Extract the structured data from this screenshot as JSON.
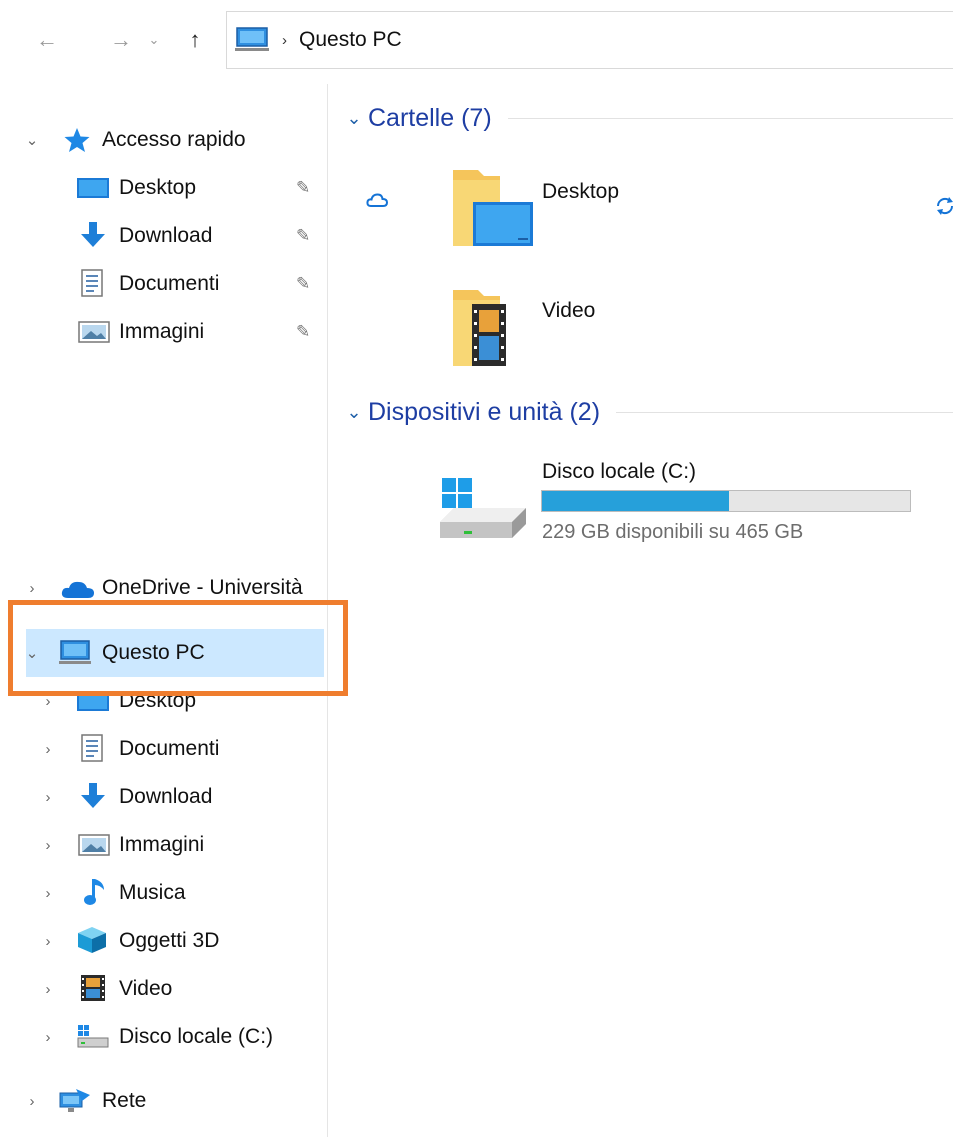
{
  "nav": {
    "back_icon": "arrow-left",
    "forward_icon": "arrow-right",
    "recent_icon": "chevron-down",
    "up_icon": "arrow-up",
    "back_glyph": "←",
    "forward_glyph": "→",
    "recent_glyph": "⌄",
    "up_glyph": "↑",
    "separator_glyph": "›"
  },
  "address": {
    "path": "Questo PC"
  },
  "sidebar": {
    "quick_access": {
      "label": "Accesso rapido",
      "expand_glyph": "⌄",
      "items": [
        {
          "label": "Desktop",
          "icon": "desktop-icon",
          "pinned": true
        },
        {
          "label": "Download",
          "icon": "download-icon",
          "pinned": true
        },
        {
          "label": "Documenti",
          "icon": "documents-icon",
          "pinned": true
        },
        {
          "label": "Immagini",
          "icon": "pictures-icon",
          "pinned": true
        }
      ]
    },
    "onedrive": {
      "label": "OneDrive - Università"
    },
    "this_pc": {
      "label": "Questo PC",
      "items": [
        {
          "label": "Desktop"
        },
        {
          "label": "Documenti"
        },
        {
          "label": "Download"
        },
        {
          "label": "Immagini"
        },
        {
          "label": "Musica"
        },
        {
          "label": "Oggetti 3D"
        },
        {
          "label": "Video"
        },
        {
          "label": "Disco locale (C:)"
        }
      ]
    },
    "network": {
      "label": "Rete"
    },
    "collapsed_glyph": "›",
    "pin_glyph": "📌"
  },
  "main": {
    "folders_group": {
      "title": "Cartelle (7)"
    },
    "folders": [
      {
        "name": "Desktop",
        "status_left": "cloud-icon",
        "status_right": "sync-icon"
      },
      {
        "name": "Video"
      }
    ],
    "devices_group": {
      "title": "Dispositivi e unità (2)"
    },
    "drive": {
      "name": "Disco locale (C:)",
      "info": "229 GB disponibili su 465 GB",
      "used_fraction": 0.508,
      "bar_color": "#26a0da"
    }
  },
  "colors": {
    "selection": "#cce8ff",
    "highlight_box": "#ef7d2e",
    "group_title": "#1e3ea3"
  }
}
